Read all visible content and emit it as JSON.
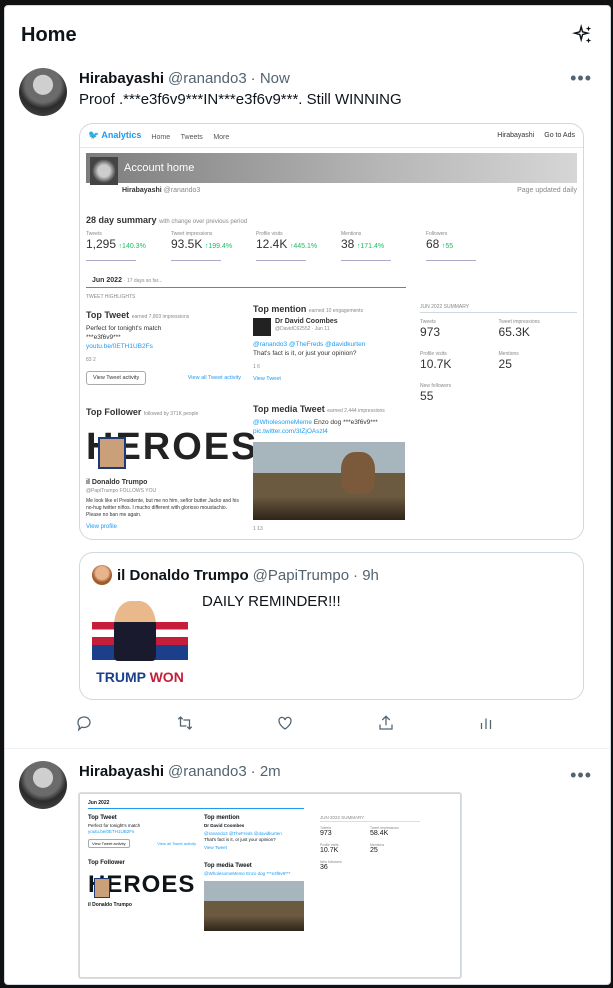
{
  "header": {
    "title": "Home"
  },
  "tweet1": {
    "name": "Hirabayashi",
    "handle": "@ranando3",
    "time": "· Now",
    "text": "Proof .***e3f6v9***IN***e3f6v9***. Still WINNING",
    "analytics": {
      "logo": "Analytics",
      "nav": [
        "Home",
        "Tweets",
        "More"
      ],
      "user_menu": "Hirabayashi",
      "go_to_ads": "Go to Ads",
      "banner": "Account home",
      "account_name": "Hirabayashi",
      "account_handle": "@ranando3",
      "updated": "Page updated daily",
      "summary_title": "28 day summary",
      "summary_sub": "with change over previous period",
      "stats": [
        {
          "label": "Tweets",
          "value": "1,295",
          "delta": "↑140.3%"
        },
        {
          "label": "Tweet impressions",
          "value": "93.5K",
          "delta": "↑199.4%"
        },
        {
          "label": "Profile visits",
          "value": "12.4K",
          "delta": "↑445.1%"
        },
        {
          "label": "Mentions",
          "value": "38",
          "delta": "↑171.4%"
        },
        {
          "label": "Followers",
          "value": "68",
          "delta": "↑55"
        }
      ],
      "month": "Jun 2022",
      "month_sub": "· 17 days so far...",
      "highlights_label": "TWEET HIGHLIGHTS",
      "top_tweet": {
        "title": "Top Tweet",
        "sub": "earned 7,803 impressions",
        "text": "Perfect for tonight's match",
        "text2": "***e3f6v9***",
        "link": "youtu.be/0ETH1UB2Fs",
        "meta": "83  2",
        "button": "View Tweet activity",
        "all_link": "View all Tweet activity"
      },
      "top_mention": {
        "title": "Top mention",
        "sub": "earned 10 engagements",
        "author": "Dr David Coombes",
        "author_handle": "@DavidC62552 · Jun 11",
        "text_links": "@ranando3 @TheFreds @davidkurten",
        "text": "That's fact is it, or just your opinion?",
        "meta": "1  6",
        "view": "View Tweet"
      },
      "top_follower": {
        "title": "Top Follower",
        "sub": "followed by 371K people",
        "heroes": "HEROES",
        "name": "il Donaldo Trumpo",
        "handle": "@PapiTrumpo",
        "follows": "FOLLOWS YOU",
        "bio": "Me look like el Presidente, but me no him, señor butter Jacko and his no-hug twitter niños. I mucho different with glorioso moustachio. Please no ban me again.",
        "view": "View profile"
      },
      "top_media": {
        "title": "Top media Tweet",
        "sub": "earned 2,444 impressions",
        "text_link": "@WholesomeMeme",
        "text": "Enzo dog ***e3f6v9***",
        "link": "pic.twitter.com/3IZjOAszl4",
        "meta": "1  13"
      },
      "summary_side": {
        "title": "JUN 2022 SUMMARY",
        "items": [
          {
            "label": "Tweets",
            "value": "973"
          },
          {
            "label": "Tweet impressions",
            "value": "65.3K"
          },
          {
            "label": "Profile visits",
            "value": "10.7K"
          },
          {
            "label": "Mentions",
            "value": "25"
          },
          {
            "label": "New followers",
            "value": "55"
          }
        ]
      }
    },
    "quote": {
      "name": "il Donaldo Trumpo",
      "handle": "@PapiTrumpo",
      "time": "· 9h",
      "text": "DAILY REMINDER!!!",
      "img_word1": "TRUMP",
      "img_word2": "WON"
    }
  },
  "tweet2": {
    "name": "Hirabayashi",
    "handle": "@ranando3",
    "time": "· 2m",
    "analytics": {
      "month": "Jun 2022",
      "top_tweet": "Top Tweet",
      "top_tweet_text": "Perfect for tonight's match",
      "top_tweet_link": "youtu.be/0ETH1UB2Fs",
      "button": "View Tweet activity",
      "all_link": "View all Tweet activity",
      "top_mention": "Top mention",
      "mention_author": "Dr David Coombes",
      "mention_links": "@ranando3 @TheFreds @davidkurten",
      "mention_text": "That's fact is it, or just your opinion?",
      "view": "View Tweet",
      "top_follower": "Top Follower",
      "heroes": "HEROES",
      "follower_name": "il Donaldo Trumpo",
      "top_media": "Top media Tweet",
      "media_text": "@WholesomeMeme Enzo dog ***e3f6v9***",
      "summary_title": "JUN 2022 SUMMARY",
      "items": [
        {
          "label": "Tweets",
          "value": "973"
        },
        {
          "label": "Tweet impressions",
          "value": "58.4K"
        },
        {
          "label": "Profile visits",
          "value": "10.7K"
        },
        {
          "label": "Mentions",
          "value": "25"
        },
        {
          "label": "New followers",
          "value": "36"
        }
      ]
    }
  },
  "icons": [
    "sparkle-icon",
    "more-icon",
    "reply-icon",
    "retweet-icon",
    "like-icon",
    "share-icon",
    "analytics-icon"
  ]
}
